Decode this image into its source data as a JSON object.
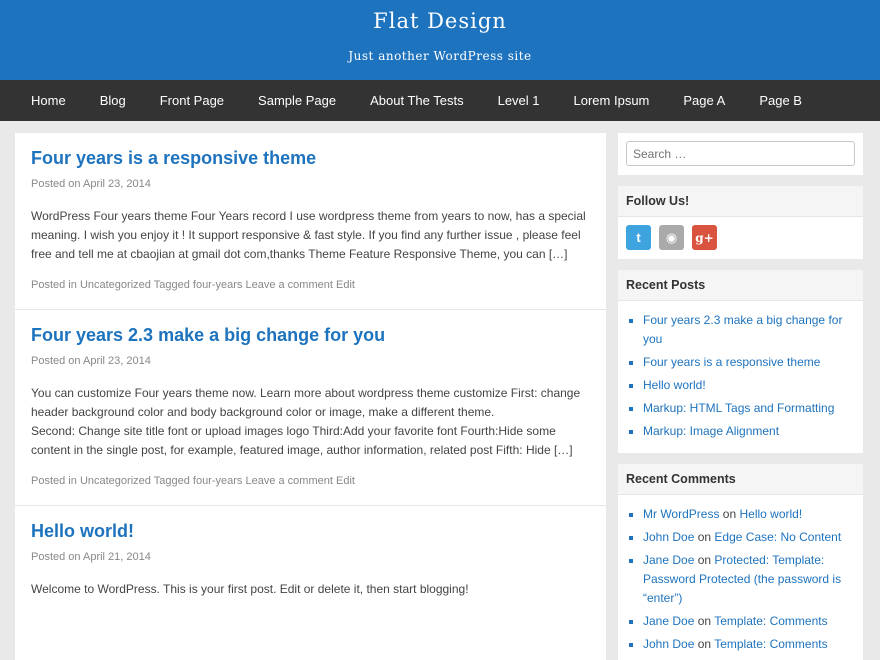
{
  "header": {
    "title": "Flat Design",
    "tagline": "Just another WordPress site"
  },
  "nav": [
    "Home",
    "Blog",
    "Front Page",
    "Sample Page",
    "About The Tests",
    "Level 1",
    "Lorem Ipsum",
    "Page A",
    "Page B"
  ],
  "posts": [
    {
      "title": "Four years is a responsive theme",
      "meta_prefix": "Posted on",
      "date": "April 23, 2014",
      "body": "WordPress Four years theme Four Years record I use wordpress theme from years to now, has a special meaning. I wish you enjoy it ! It support responsive & fast style. If you find any further  issue , please feel free and tell me at cbaojian at gmail dot com,thanks Theme Feature Responsive Theme, you can […]",
      "footer_prefix": "Posted in",
      "category": "Uncategorized",
      "tagged_prefix": "Tagged",
      "tag": "four-years",
      "comment": "Leave a comment",
      "edit": "Edit"
    },
    {
      "title": "Four years 2.3 make a big change for you",
      "meta_prefix": "Posted on",
      "date": "April 23, 2014",
      "body": "You can customize Four years theme now. Learn more about wordpress theme customize First: change header background color and body background color or image, make a different theme.",
      "body2": "Second: Change site title font or upload images logo Third:Add your favorite font Fourth:Hide some content in the single post, for example, featured image, author information, related post Fifth: Hide […]",
      "footer_prefix": "Posted in",
      "category": "Uncategorized",
      "tagged_prefix": "Tagged",
      "tag": "four-years",
      "comment": "Leave a comment",
      "edit": "Edit"
    },
    {
      "title": "Hello world!",
      "meta_prefix": "Posted on",
      "date": "April 21, 2014",
      "body": "Welcome to WordPress. This is your first post. Edit or delete it, then start blogging!"
    }
  ],
  "sidebar": {
    "search_placeholder": "Search …",
    "follow_title": "Follow Us!",
    "social_icons": [
      "twitter-icon",
      "github-icon",
      "google-plus-icon"
    ],
    "social_glyphs": [
      "t",
      "◉",
      "g+"
    ],
    "recent_posts_title": "Recent Posts",
    "recent_posts": [
      "Four years 2.3 make a big change for you",
      "Four years is a responsive theme",
      "Hello world!",
      "Markup: HTML Tags and Formatting",
      "Markup: Image Alignment"
    ],
    "recent_comments_title": "Recent Comments",
    "on_word": "on",
    "recent_comments": [
      {
        "author": "Mr WordPress",
        "post": "Hello world!"
      },
      {
        "author": "John Doe",
        "post": "Edge Case: No Content"
      },
      {
        "author": "Jane Doe",
        "post": "Protected: Template: Password Protected (the password is “enter”)"
      },
      {
        "author": "Jane Doe",
        "post": "Template: Comments"
      },
      {
        "author": "John Doe",
        "post": "Template: Comments"
      }
    ]
  },
  "colors": {
    "accent": "#1e73be",
    "nav_bg": "#333333",
    "page_bg": "#e9e9e9"
  }
}
